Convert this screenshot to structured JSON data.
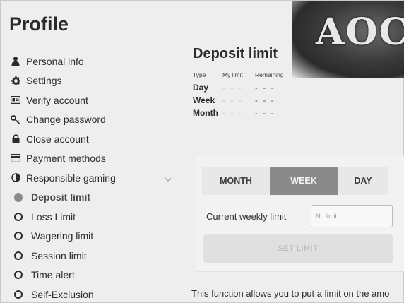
{
  "sidebar": {
    "title": "Profile",
    "items": [
      {
        "label": "Personal info",
        "icon": "user-icon"
      },
      {
        "label": "Settings",
        "icon": "gear-icon"
      },
      {
        "label": "Verify account",
        "icon": "id-card-icon"
      },
      {
        "label": "Change password",
        "icon": "key-icon"
      },
      {
        "label": "Close account",
        "icon": "lock-icon"
      },
      {
        "label": "Payment methods",
        "icon": "credit-card-icon"
      },
      {
        "label": "Responsible gaming",
        "icon": "half-circle-icon"
      }
    ],
    "sub_items": [
      {
        "label": "Deposit limit",
        "active": true
      },
      {
        "label": "Loss Limit",
        "active": false
      },
      {
        "label": "Wagering limit",
        "active": false
      },
      {
        "label": "Session limit",
        "active": false
      },
      {
        "label": "Time alert",
        "active": false
      },
      {
        "label": "Self-Exclusion",
        "active": false
      }
    ]
  },
  "logo": {
    "text": "AOC"
  },
  "deposit": {
    "title": "Deposit limit",
    "headers": {
      "type": "Type",
      "my_limit": "My limit",
      "remaining": "Remaining"
    },
    "rows": [
      {
        "type": "Day",
        "my_limit": "- - -",
        "remaining": "- - -"
      },
      {
        "type": "Week",
        "my_limit": "- - -",
        "remaining": "- - -"
      },
      {
        "type": "Month",
        "my_limit": "- - -",
        "remaining": "- - -"
      }
    ],
    "tabs": {
      "month": "MONTH",
      "week": "WEEK",
      "day": "DAY"
    },
    "current_label": "Current weekly limit",
    "input_placeholder": "No limit",
    "set_button": "SET LIMIT",
    "footer": "This function allows you to put a limit on the amo"
  },
  "colors": {
    "accent": "#8a8a8a",
    "background": "#eeeeee",
    "text": "#2a2a2a"
  }
}
